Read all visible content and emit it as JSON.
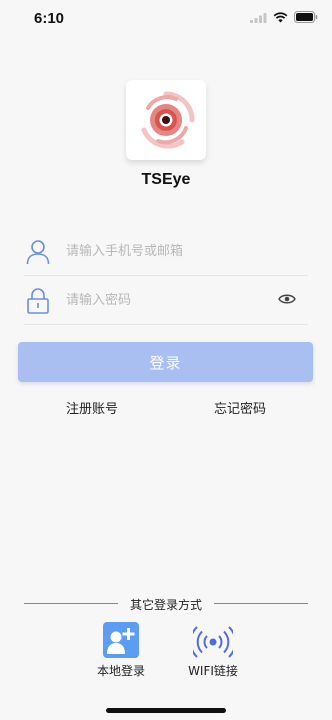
{
  "status_bar": {
    "time": "6:10"
  },
  "app": {
    "name": "TSEye"
  },
  "form": {
    "account_placeholder": "请输入手机号或邮箱",
    "password_placeholder": "请输入密码",
    "login_label": "登录",
    "register_label": "注册账号",
    "forgot_label": "忘记密码"
  },
  "other_login": {
    "title": "其它登录方式",
    "options": [
      {
        "label": "本地登录",
        "icon": "add-user-icon"
      },
      {
        "label": "WIFI链接",
        "icon": "wifi-signal-icon"
      }
    ]
  },
  "colors": {
    "accent": "#a9bff2",
    "icon_blue": "#6a8fe0",
    "logo_red": "#d9534f"
  }
}
